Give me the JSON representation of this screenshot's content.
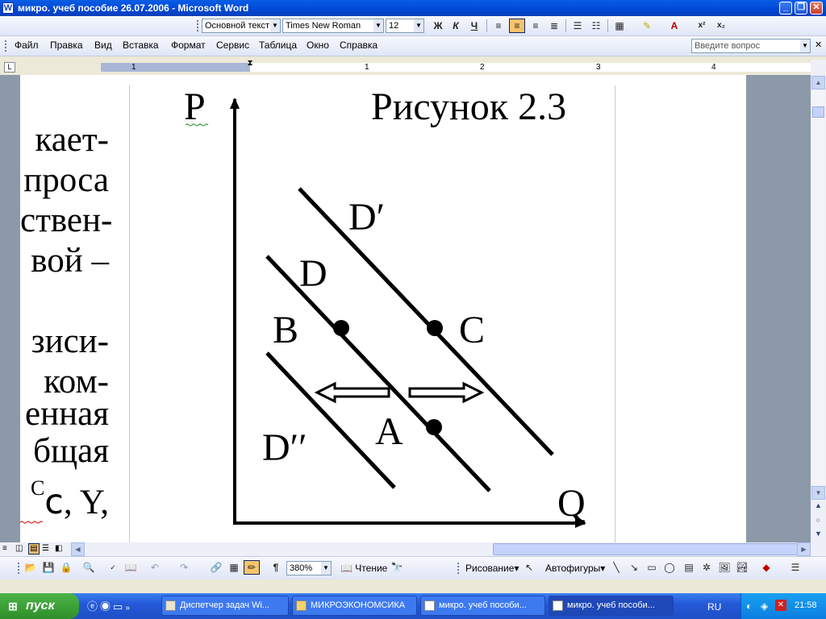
{
  "window": {
    "title": "микро. учеб пособие 26.07.2006 - Microsoft Word",
    "app_icon": "word-icon"
  },
  "format_toolbar": {
    "style": "Основной текст",
    "font": "Times New Roman",
    "size": "12",
    "bold": "Ж",
    "italic": "К",
    "underline": "Ч",
    "superscript": "x²",
    "subscript": "x₂"
  },
  "menu": {
    "items": [
      "Файл",
      "Правка",
      "Вид",
      "Вставка",
      "Формат",
      "Сервис",
      "Таблица",
      "Окно",
      "Справка"
    ],
    "help_placeholder": "Введите вопрос"
  },
  "ruler": {
    "numbers": [
      "1",
      "1",
      "2",
      "3",
      "4"
    ]
  },
  "document": {
    "left_text": [
      "кает-",
      "проса",
      "ствен-",
      "вой  –",
      "зиси-",
      "ком-",
      "енная",
      "бщая",
      "ⅽ,  Y,"
    ],
    "superscript_c": "C"
  },
  "figure": {
    "title": "Рисунок 2.3",
    "axis_p": "P",
    "axis_q": "Q",
    "label_d_prime": "D′",
    "label_d": "D",
    "label_d_double": "D′′",
    "point_a": "A",
    "point_b": "B",
    "point_c": "C"
  },
  "standard_toolbar": {
    "zoom": "380%",
    "reading": "Чтение",
    "paragraph": "¶"
  },
  "drawing_toolbar": {
    "drawing": "Рисование",
    "autoshapes": "Автофигуры"
  },
  "taskbar": {
    "start": "пуск",
    "tasks": [
      "Диспетчер задач Wi...",
      "МИКРОЭКОНОМСИКА",
      "микро. учеб пособи...",
      "микро. учеб пособи..."
    ],
    "language": "RU",
    "clock": "21:58"
  }
}
